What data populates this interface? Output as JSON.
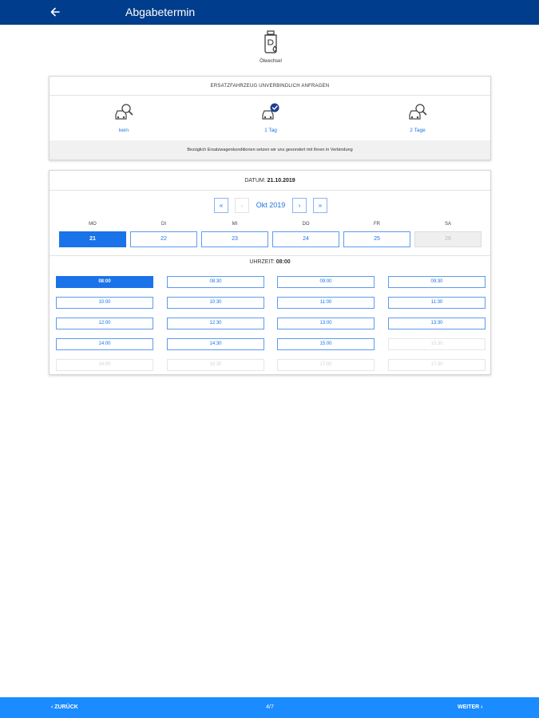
{
  "header": {
    "title": "Abgabetermin"
  },
  "service": {
    "label": "Ölwechsel"
  },
  "replacement": {
    "heading": "ERSATZFAHRZEUG UNVERBINDLICH ANFRAGEN",
    "options": [
      {
        "label": "kein",
        "selected": false
      },
      {
        "label": "1 Tag",
        "selected": true
      },
      {
        "label": "2 Tage",
        "selected": false
      }
    ],
    "note": "Bezüglich Ersatzwagenkonditionen setzen wir uns gesondert mit Ihnen in Verbindung"
  },
  "calendar": {
    "date_label": "DATUM:",
    "date_value": "21.10.2019",
    "month": "Okt 2019",
    "nav": {
      "first": "«",
      "prev": "‹",
      "next": "›",
      "last": "»"
    },
    "days": [
      {
        "name": "MO",
        "num": "21",
        "state": "selected"
      },
      {
        "name": "DI",
        "num": "22",
        "state": "available"
      },
      {
        "name": "MI",
        "num": "23",
        "state": "available"
      },
      {
        "name": "DO",
        "num": "24",
        "state": "available"
      },
      {
        "name": "FR",
        "num": "25",
        "state": "available"
      },
      {
        "name": "SA",
        "num": "26",
        "state": "disabled"
      }
    ],
    "time_label": "UHRZEIT:",
    "time_value": "08:00",
    "times": [
      {
        "t": "08:00",
        "state": "selected"
      },
      {
        "t": "08:30",
        "state": "available"
      },
      {
        "t": "09:00",
        "state": "available"
      },
      {
        "t": "09:30",
        "state": "available"
      },
      {
        "t": "10:00",
        "state": "available"
      },
      {
        "t": "10:30",
        "state": "available"
      },
      {
        "t": "11:00",
        "state": "available"
      },
      {
        "t": "11:30",
        "state": "available"
      },
      {
        "t": "12:00",
        "state": "available"
      },
      {
        "t": "12:30",
        "state": "available"
      },
      {
        "t": "13:00",
        "state": "available"
      },
      {
        "t": "13:30",
        "state": "available"
      },
      {
        "t": "14:00",
        "state": "available"
      },
      {
        "t": "14:30",
        "state": "available"
      },
      {
        "t": "15:00",
        "state": "available"
      },
      {
        "t": "15:30",
        "state": "disabled"
      },
      {
        "t": "16:00",
        "state": "disabled"
      },
      {
        "t": "16:30",
        "state": "disabled"
      },
      {
        "t": "17:00",
        "state": "disabled"
      },
      {
        "t": "17:30",
        "state": "disabled"
      }
    ]
  },
  "footer": {
    "back": "ZURÜCK",
    "page": "4/7",
    "next": "WEITER"
  },
  "colors": {
    "header": "#003d8c",
    "accent": "#1a73e8",
    "footer": "#1a8cff"
  },
  "icons": {
    "back": "arrow-left-icon",
    "service": "oil-can-icon",
    "car": "car-search-icon",
    "check": "check-badge-icon"
  }
}
